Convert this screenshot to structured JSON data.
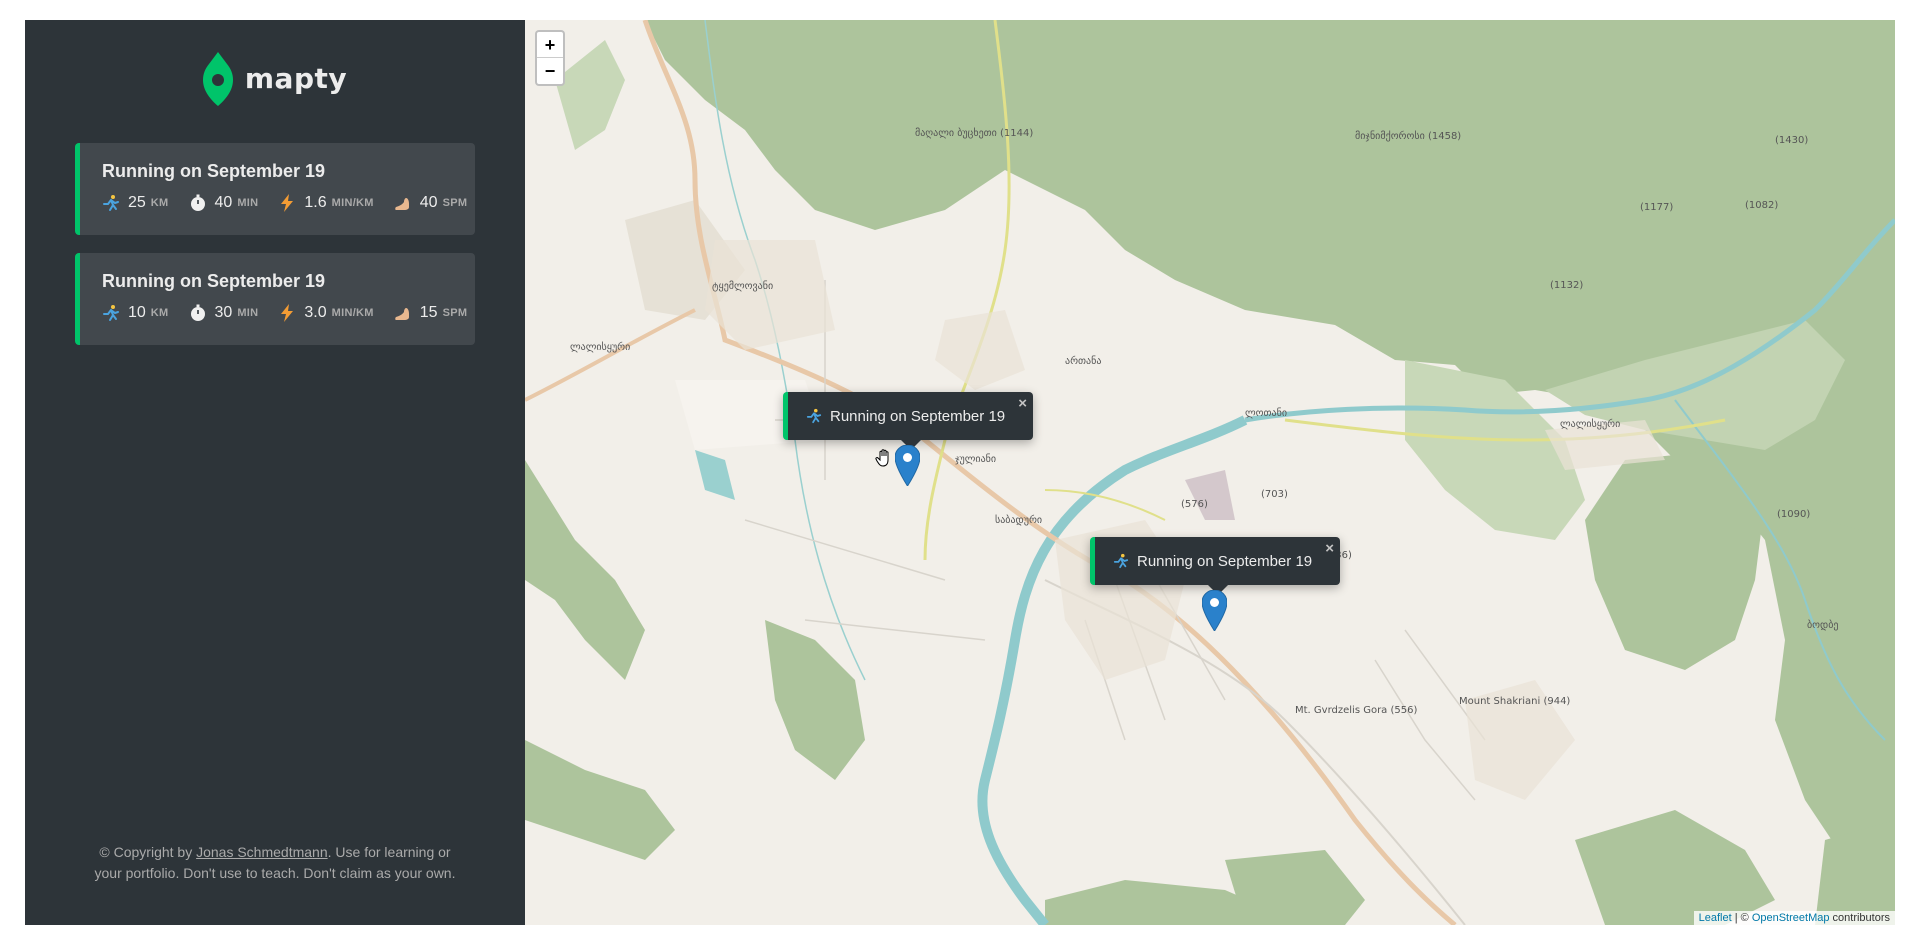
{
  "brand": {
    "name": "mapty",
    "accent": "#00c46a"
  },
  "workouts": [
    {
      "title": "Running on September 19",
      "distance": {
        "icon": "runner-icon",
        "value": "25",
        "unit": "km"
      },
      "duration": {
        "icon": "stopwatch-icon",
        "value": "40",
        "unit": "min"
      },
      "pace": {
        "icon": "lightning-icon",
        "value": "1.6",
        "unit": "min/km"
      },
      "cadence": {
        "icon": "foot-icon",
        "value": "40",
        "unit": "spm"
      }
    },
    {
      "title": "Running on September 19",
      "distance": {
        "icon": "runner-icon",
        "value": "10",
        "unit": "km"
      },
      "duration": {
        "icon": "stopwatch-icon",
        "value": "30",
        "unit": "min"
      },
      "pace": {
        "icon": "lightning-icon",
        "value": "3.0",
        "unit": "min/km"
      },
      "cadence": {
        "icon": "foot-icon",
        "value": "15",
        "unit": "spm"
      }
    }
  ],
  "copyright": {
    "prefix": "© Copyright by ",
    "author": "Jonas Schmedtmann",
    "suffix": ". Use for learning or your portfolio. Don't use to teach. Don't claim as your own."
  },
  "map": {
    "zoom_in": "+",
    "zoom_out": "−",
    "popups": [
      {
        "title": "Running on September 19",
        "close": "×"
      },
      {
        "title": "Running on September 19",
        "close": "×"
      }
    ],
    "labels": {
      "l1": "მაღალი ბუცხეთი (1144)",
      "l2": "მიჯნიმქოროსი (1458)",
      "l3": "(1430)",
      "l4": "(1177)",
      "l5": "(1082)",
      "l6": "(1132)",
      "l7": "ტყემლოვანი",
      "l8": "ლალისყური",
      "l9": "ართანა",
      "l10": "ლოთანი",
      "l11": "ლალისყური",
      "l12": "ჯულიანი",
      "l13": "საბადური",
      "l14": "(576)",
      "l15": "(703)",
      "l16": "(1090)",
      "l17": "(736)",
      "l18": "Mt. Gvrdzelis Gora (556)",
      "l19": "Mount Shakriani (944)",
      "l20": "ბოდბე"
    },
    "attribution": {
      "leaflet": "Leaflet",
      "sep": " | © ",
      "osm": "OpenStreetMap",
      "suffix": " contributors"
    }
  }
}
